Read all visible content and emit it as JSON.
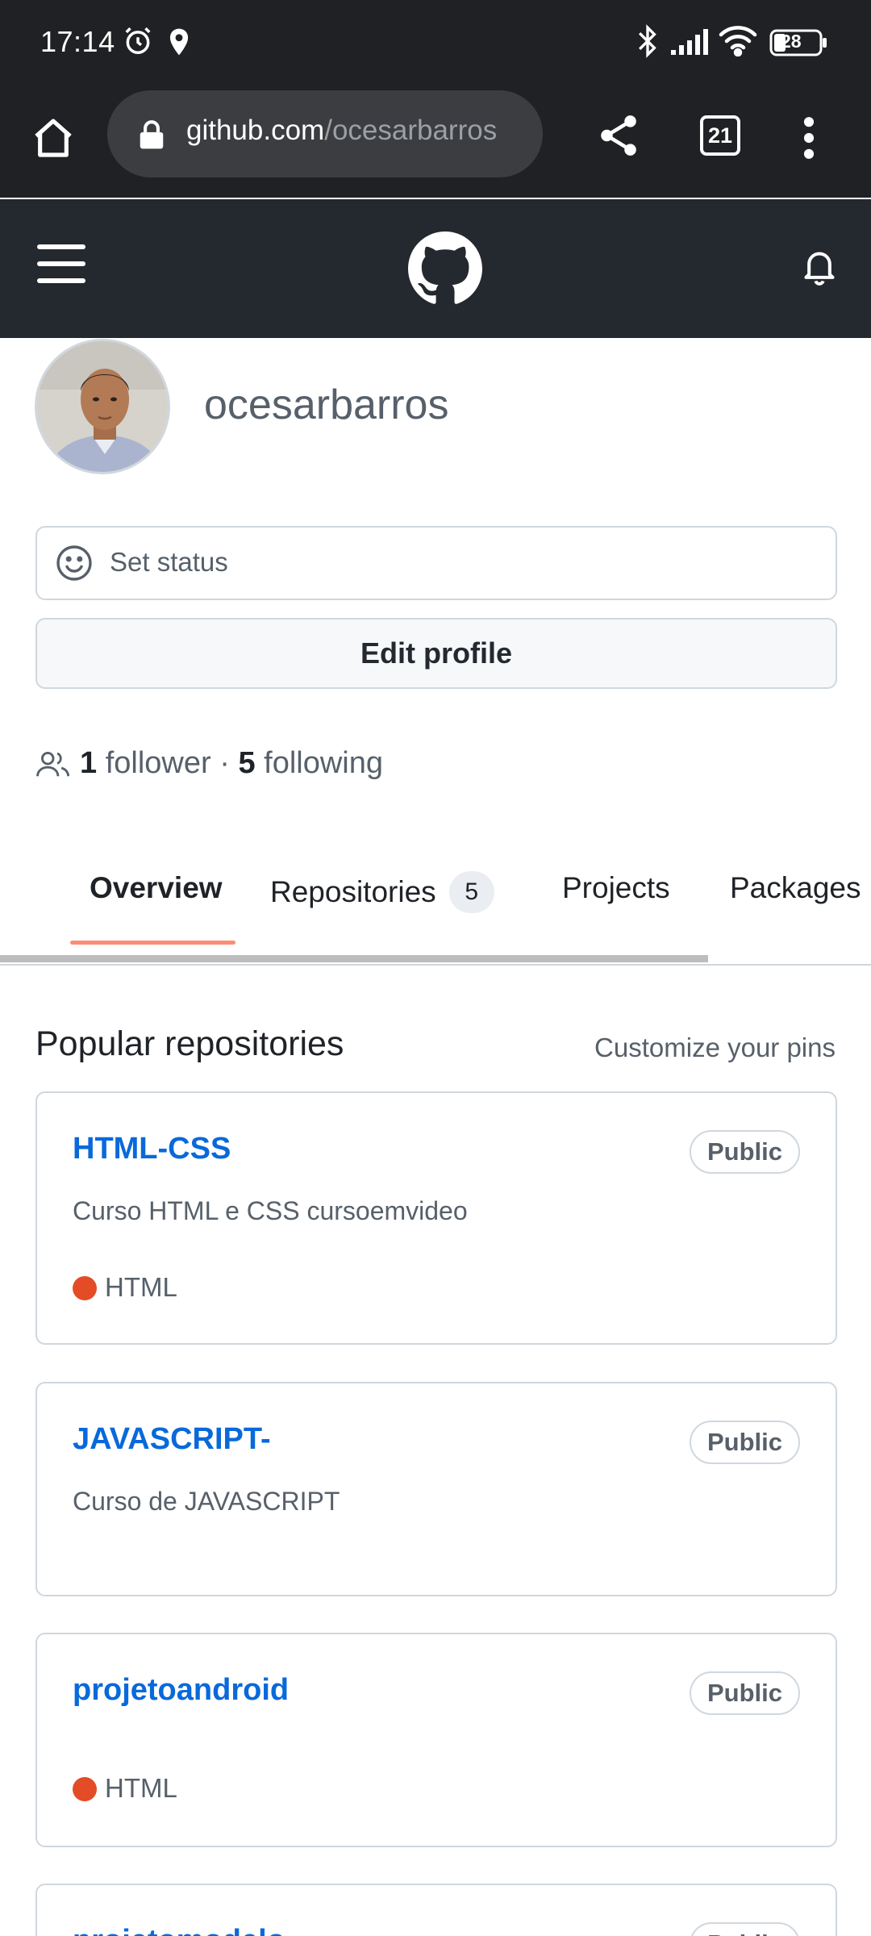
{
  "status_bar": {
    "time": "17:14",
    "battery": "28"
  },
  "browser": {
    "url_host": "github.com",
    "url_path": "/ocesarbarros",
    "tab_count": "21"
  },
  "profile": {
    "username": "ocesarbarros",
    "set_status_label": "Set status",
    "edit_profile_label": "Edit profile",
    "followers_count": "1",
    "followers_label": "follower",
    "separator": "·",
    "following_count": "5",
    "following_label": "following"
  },
  "tabs": [
    {
      "label": "Overview",
      "active": true
    },
    {
      "label": "Repositories",
      "counter": "5"
    },
    {
      "label": "Projects"
    },
    {
      "label": "Packages"
    }
  ],
  "popular": {
    "title": "Popular repositories",
    "customize_label": "Customize your pins",
    "repos": [
      {
        "name": "HTML-CSS",
        "visibility": "Public",
        "description": "Curso HTML e CSS cursoemvideo",
        "language": "HTML",
        "language_color": "#e34c26"
      },
      {
        "name": "JAVASCRIPT-",
        "visibility": "Public",
        "description": "Curso de JAVASCRIPT",
        "language": ""
      },
      {
        "name": "projetoandroid",
        "visibility": "Public",
        "description": "",
        "language": "HTML",
        "language_color": "#e34c26"
      },
      {
        "name": "projetomodelo",
        "visibility": "Public"
      }
    ]
  },
  "colors": {
    "browser_chrome": "#202124",
    "github_header": "#24292f",
    "link_blue": "#0969da",
    "tab_underline": "#fd8c73",
    "html_language": "#e34c26"
  }
}
